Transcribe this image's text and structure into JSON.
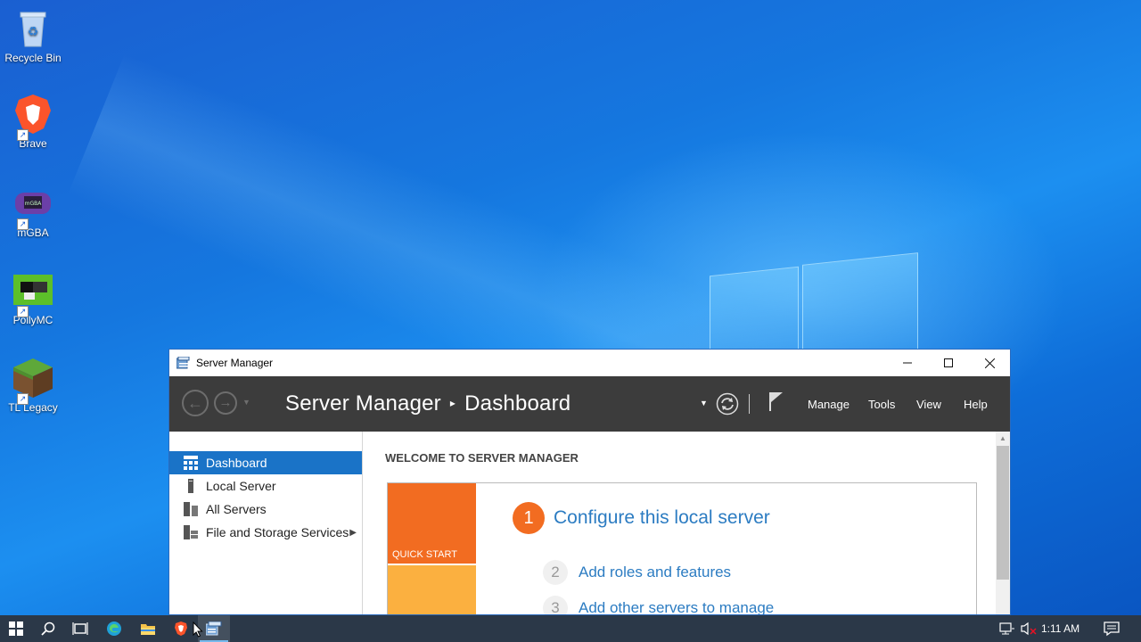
{
  "desktop": {
    "icons": [
      {
        "label": "Recycle Bin"
      },
      {
        "label": "Brave"
      },
      {
        "label": "mGBA"
      },
      {
        "label": "PollyMC"
      },
      {
        "label": "TL Legacy"
      }
    ]
  },
  "window": {
    "title": "Server Manager",
    "breadcrumb": {
      "root": "Server Manager",
      "current": "Dashboard"
    },
    "menu": {
      "manage": "Manage",
      "tools": "Tools",
      "view": "View",
      "help": "Help"
    },
    "sidebar": {
      "items": [
        {
          "label": "Dashboard",
          "icon": "dashboard-grid-icon",
          "active": true
        },
        {
          "label": "Local Server",
          "icon": "server-icon"
        },
        {
          "label": "All Servers",
          "icon": "servers-icon"
        },
        {
          "label": "File and Storage Services",
          "icon": "storage-icon"
        }
      ]
    },
    "content": {
      "welcome": "WELCOME TO SERVER MANAGER",
      "quick_start_label": "QUICK START",
      "steps": [
        {
          "num": "1",
          "label": "Configure this local server"
        },
        {
          "num": "2",
          "label": "Add roles and features"
        },
        {
          "num": "3",
          "label": "Add other servers to manage"
        }
      ]
    }
  },
  "taskbar": {
    "clock": "1:11 AM",
    "pinned": [
      "start-icon",
      "search-icon",
      "task-view-icon",
      "edge-icon",
      "file-explorer-icon",
      "brave-icon",
      "server-manager-icon"
    ]
  },
  "colors": {
    "accent": "#1a73c7",
    "quickstart_orange": "#f26c21",
    "quickstart_yellow": "#fbb040",
    "link_blue": "#2c7cc2",
    "header_dark": "#3c3c3c",
    "taskbar": "#2b3848"
  }
}
